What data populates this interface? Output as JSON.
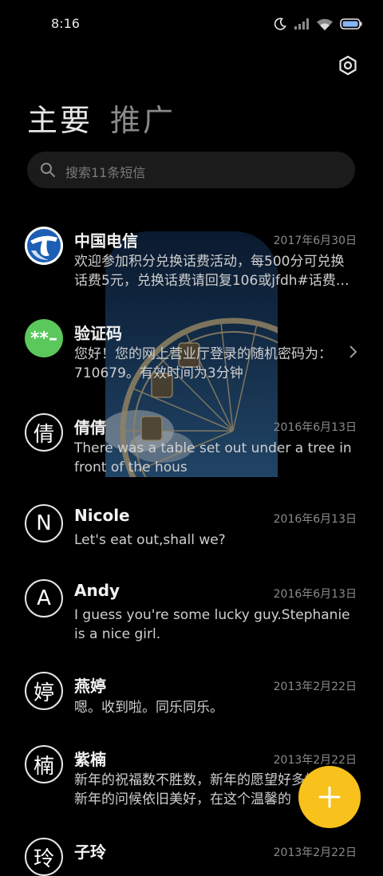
{
  "status_bar": {
    "time": "8:16"
  },
  "tabs": [
    {
      "label": "主要",
      "active": true
    },
    {
      "label": "推广",
      "active": false
    }
  ],
  "search": {
    "placeholder": "搜索11条短信"
  },
  "conversations": [
    {
      "name": "中国电信",
      "date": "2017年6月30日",
      "message": "欢迎参加积分兑换话费活动，每500分可兑换话费5元，兑换话费请回复106或jfdh#话费…",
      "avatar": "china-telecom-logo"
    },
    {
      "name": "验证码",
      "date": "",
      "message": "您好！您的网上营业厅登录的随机密码为：710679。有效时间为3分钟",
      "avatar_text": "**–"
    },
    {
      "name": "倩倩",
      "date": "2016年6月13日",
      "message": "There was a table set out under a tree in front of the hous",
      "avatar_text": "倩"
    },
    {
      "name": "Nicole",
      "date": "2016年6月13日",
      "message": "Let's eat out,shall we?",
      "avatar_text": "N"
    },
    {
      "name": "Andy",
      "date": "2016年6月13日",
      "message": "I guess you're some lucky guy.Stephanie is a nice girl.",
      "avatar_text": "A"
    },
    {
      "name": "燕婷",
      "date": "2013年2月22日",
      "message": "嗯。收到啦。同乐同乐。",
      "avatar_text": "婷"
    },
    {
      "name": "紫楠",
      "date": "2013年2月22日",
      "message": "新年的祝福数不胜数，新年的愿望好多好多，新年的问候依旧美好，在这个温馨的",
      "avatar_text": "楠"
    },
    {
      "name": "子玲",
      "date": "2013年2月22日",
      "message": "",
      "avatar_text": "玲"
    }
  ],
  "colors": {
    "background": "#000000",
    "fab": "#f8c11b",
    "avatar_green": "#5ac85a",
    "telecom_blue": "#1c5fb5"
  },
  "icons": [
    "moon-icon",
    "signal-icon",
    "wifi-icon",
    "battery-icon",
    "settings-icon",
    "search-icon",
    "chevron-right-icon",
    "plus-icon"
  ]
}
